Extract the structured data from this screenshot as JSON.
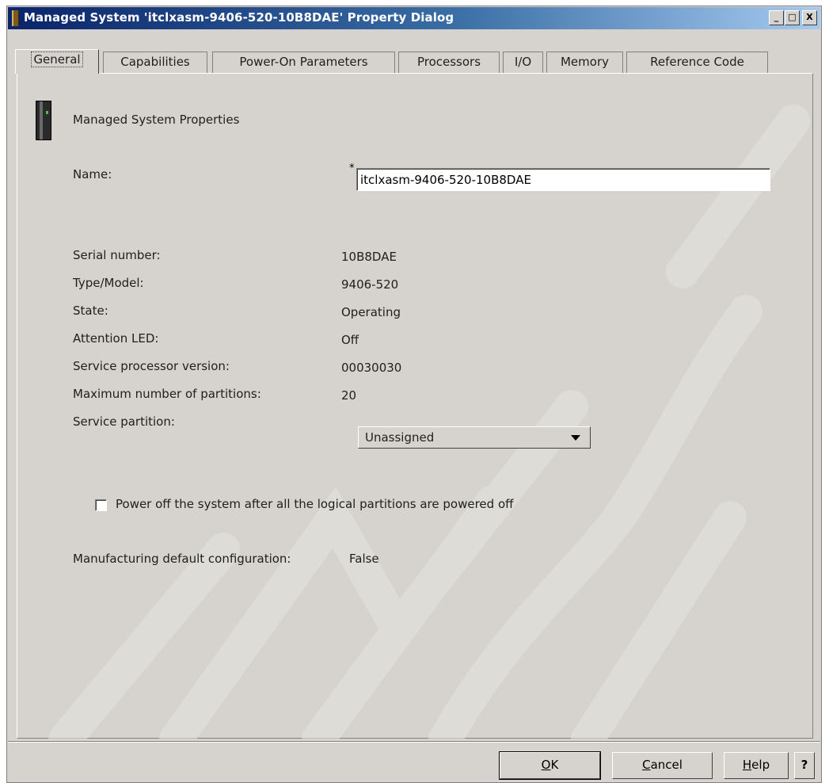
{
  "window": {
    "title": "Managed System 'itclxasm-9406-520-10B8DAE' Property Dialog",
    "controls": {
      "minimize": "_",
      "maximize": "□",
      "close": "X"
    }
  },
  "tabs": [
    {
      "label": "General",
      "active": true
    },
    {
      "label": "Capabilities"
    },
    {
      "label": "Power-On Parameters"
    },
    {
      "label": "Processors"
    },
    {
      "label": "I/O"
    },
    {
      "label": "Memory"
    },
    {
      "label": "Reference Code"
    }
  ],
  "general": {
    "heading": "Managed System Properties",
    "name_label": "Name:",
    "required_marker": "*",
    "name_value": "itclxasm-9406-520-10B8DAE",
    "fields": [
      {
        "label": "Serial number:",
        "value": "10B8DAE"
      },
      {
        "label": "Type/Model:",
        "value": "9406-520"
      },
      {
        "label": "State:",
        "value": "Operating"
      },
      {
        "label": "Attention LED:",
        "value": "Off"
      },
      {
        "label": "Service processor version:",
        "value": "00030030"
      },
      {
        "label": "Maximum number of partitions:",
        "value": "20"
      }
    ],
    "service_partition_label": "Service partition:",
    "service_partition_value": "Unassigned",
    "power_off_checkbox": {
      "label": "Power off the system after all the logical partitions are powered off",
      "checked": false
    },
    "mfg_default_label": "Manufacturing default configuration:",
    "mfg_default_value": "False"
  },
  "buttons": {
    "ok": {
      "mnemonic": "O",
      "rest": "K"
    },
    "cancel": {
      "mnemonic": "C",
      "rest": "ancel"
    },
    "help": {
      "mnemonic": "H",
      "rest": "elp"
    },
    "context_help": "?"
  }
}
